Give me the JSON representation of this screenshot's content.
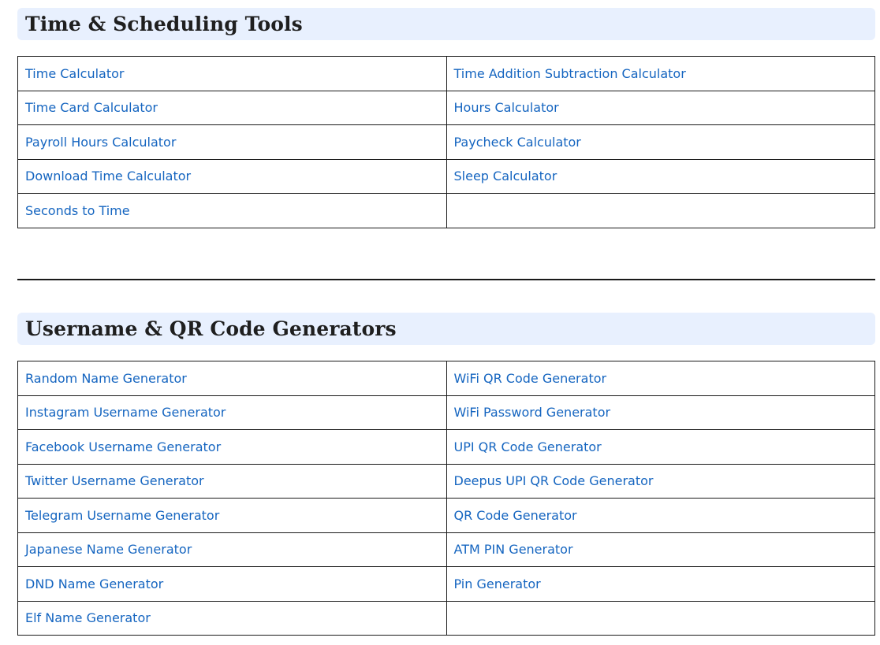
{
  "sections": [
    {
      "title": "Time & Scheduling Tools",
      "rows": [
        [
          "Time Calculator",
          "Time Addition Subtraction Calculator"
        ],
        [
          "Time Card Calculator",
          "Hours Calculator"
        ],
        [
          "Payroll Hours Calculator",
          "Paycheck Calculator"
        ],
        [
          "Download Time Calculator",
          "Sleep Calculator"
        ],
        [
          "Seconds to Time",
          ""
        ]
      ]
    },
    {
      "title": "Username & QR Code Generators",
      "rows": [
        [
          "Random Name Generator",
          "WiFi QR Code Generator"
        ],
        [
          "Instagram Username Generator",
          "WiFi Password Generator"
        ],
        [
          "Facebook Username Generator",
          "UPI QR Code Generator"
        ],
        [
          "Twitter Username Generator",
          "Deepus UPI QR Code Generator"
        ],
        [
          "Telegram Username Generator",
          "QR Code Generator"
        ],
        [
          "Japanese Name Generator",
          "ATM PIN Generator"
        ],
        [
          "DND Name Generator",
          "Pin Generator"
        ],
        [
          "Elf Name Generator",
          ""
        ]
      ]
    }
  ],
  "colors": {
    "heading_background": "#e8f0fe",
    "link": "#1565c0",
    "heading_text": "#1f1f1f",
    "border": "#1a1a1a"
  }
}
